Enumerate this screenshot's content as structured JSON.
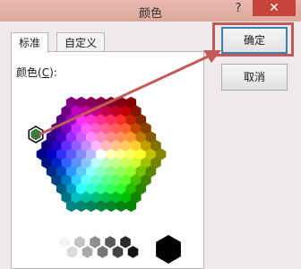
{
  "window": {
    "title": "颜色",
    "help_glyph": "?",
    "close_glyph": "✕"
  },
  "tabs": [
    {
      "label": "标准",
      "active": true
    },
    {
      "label": "自定义",
      "active": false
    }
  ],
  "colors_label": {
    "text_before": "颜色(",
    "accelerator": "C",
    "text_after": "):"
  },
  "buttons": {
    "ok": "确定",
    "cancel": "取消"
  },
  "annotation": {
    "color": "#c35a5a"
  },
  "selected_color": "#3f7a3f"
}
